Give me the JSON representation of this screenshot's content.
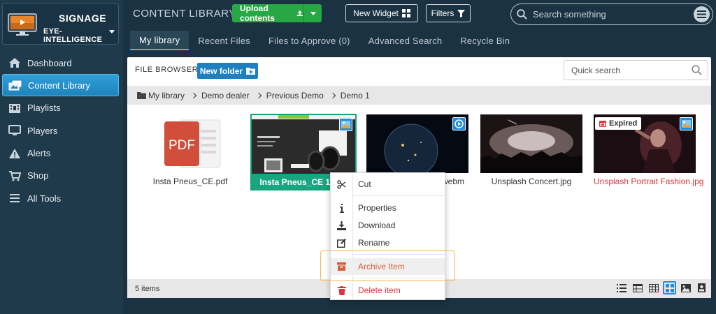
{
  "brand": {
    "title": "SIGNAGE",
    "account": "Eye-Intelligence"
  },
  "nav": [
    {
      "label": "Dashboard",
      "icon": "home-icon",
      "active": false
    },
    {
      "label": "Content Library",
      "icon": "images-icon",
      "active": true
    },
    {
      "label": "Playlists",
      "icon": "film-icon",
      "active": false
    },
    {
      "label": "Players",
      "icon": "monitor-icon",
      "active": false
    },
    {
      "label": "Alerts",
      "icon": "warning-icon",
      "active": false
    },
    {
      "label": "Shop",
      "icon": "cart-icon",
      "active": false
    },
    {
      "label": "All Tools",
      "icon": "menu-icon",
      "active": false
    }
  ],
  "header": {
    "title": "CONTENT LIBRARY",
    "upload_label": "Upload contents",
    "widget_label": "New Widget",
    "filters_label": "Filters",
    "search_placeholder": "Search something"
  },
  "tabs": [
    {
      "label": "My library",
      "active": true
    },
    {
      "label": "Recent Files",
      "active": false
    },
    {
      "label": "Files to Approve (0)",
      "active": false
    },
    {
      "label": "Advanced Search",
      "active": false
    },
    {
      "label": "Recycle Bin",
      "active": false
    }
  ],
  "browser": {
    "label": "FILE BROWSER",
    "new_folder_label": "New folder",
    "quick_search_placeholder": "Quick search",
    "breadcrumb": [
      "My library",
      "Demo dealer",
      "Previous Demo",
      "Demo 1"
    ],
    "footer_count": "5 items"
  },
  "files": [
    {
      "name": "Insta Pneus_CE.pdf",
      "kind": "pdf"
    },
    {
      "name": "Insta Pneus_CE 1 of 1",
      "kind": "image",
      "selected": true
    },
    {
      "name": "webm",
      "kind": "video"
    },
    {
      "name": "Unsplash Concert.jpg",
      "kind": "image"
    },
    {
      "name": "Unsplash Portrait Fashion.jpg",
      "kind": "image",
      "expired_label": "Expired"
    }
  ],
  "context_menu": {
    "cut": "Cut",
    "properties": "Properties",
    "download": "Download",
    "rename": "Rename",
    "archive": "Archive Item",
    "delete": "Delete item"
  },
  "colors": {
    "accent_blue": "#1f80c0",
    "upload_green": "#28a745",
    "selected_tile": "#17a680",
    "danger": "#d9363e",
    "highlight_outline": "#f3b94a"
  }
}
